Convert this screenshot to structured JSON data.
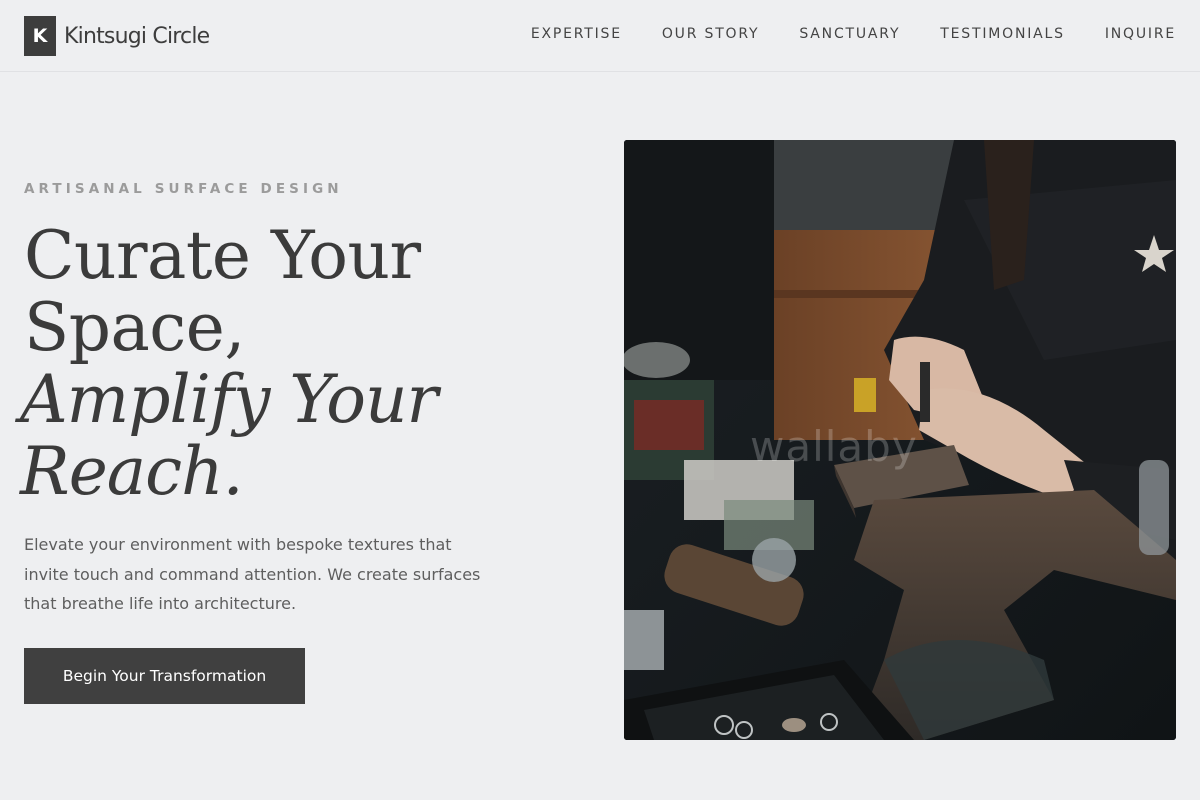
{
  "brand": {
    "mark": "K",
    "name": "Kintsugi Circle"
  },
  "nav": {
    "items": [
      "EXPERTISE",
      "OUR STORY",
      "SANCTUARY",
      "TESTIMONIALS",
      "INQUIRE"
    ]
  },
  "hero": {
    "eyebrow": "ARTISANAL SURFACE DESIGN",
    "headline": {
      "line1": "Curate Your",
      "line2": "Space,",
      "line3": "Amplify Your",
      "line4": "Reach."
    },
    "lede": "Elevate your environment with bespoke textures that invite touch and command attention. We create surfaces that breathe life into architecture.",
    "cta_label": "Begin Your Transformation",
    "photo_watermark": "wallaby"
  }
}
